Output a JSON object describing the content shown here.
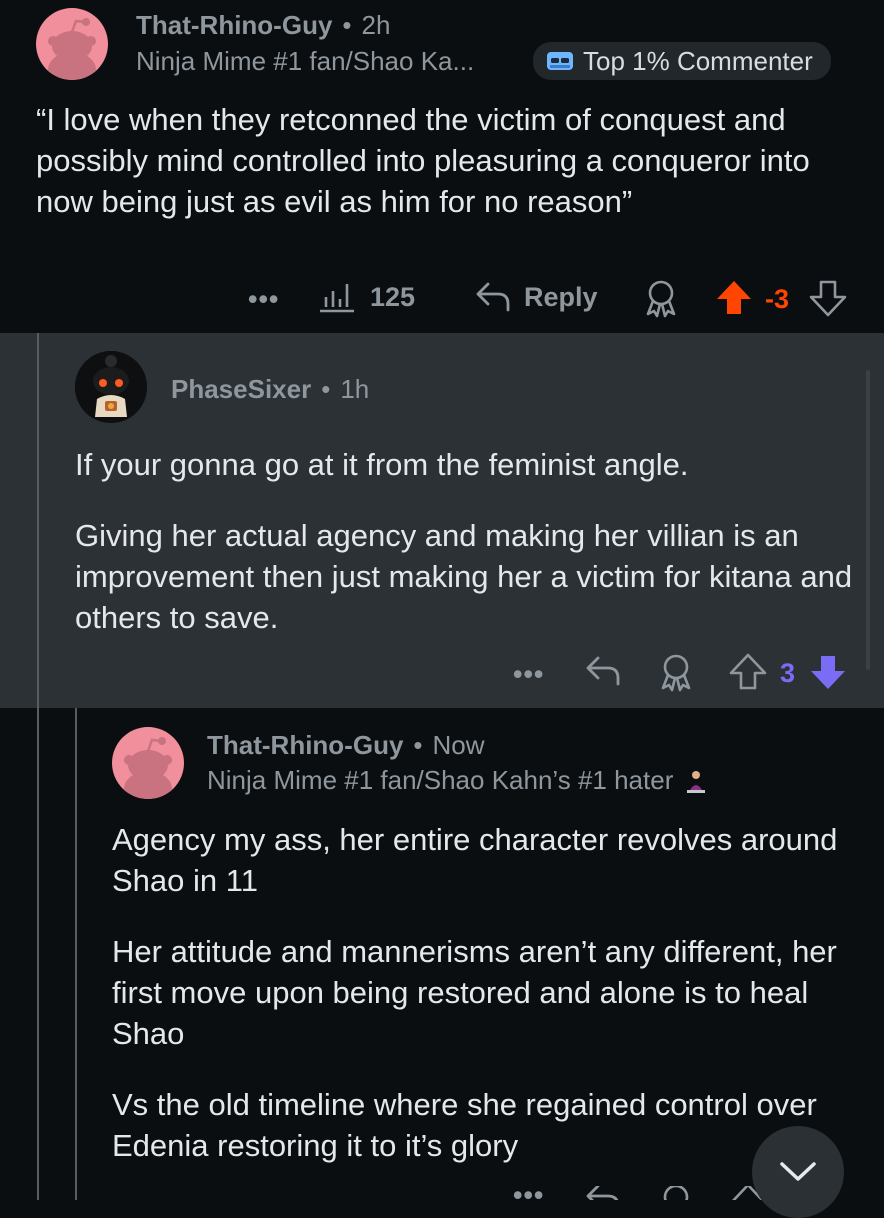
{
  "comment1": {
    "username": "That-Rhino-Guy",
    "separator": "•",
    "time": "2h",
    "flair": "Ninja Mime #1 fan/Shao Ka...",
    "badge": "Top 1% Commenter",
    "body": "“I love when they retconned the victim of conquest and possibly mind controlled into pleasuring a conqueror into now being just as evil as him for no reason”",
    "more": "•••",
    "views": "125",
    "reply": "Reply",
    "vote_count": "-3",
    "colors": {
      "upvote_active": "#ff4500",
      "vote_count": "#ff4500"
    }
  },
  "comment2": {
    "username": "PhaseSixer",
    "separator": "•",
    "time": "1h",
    "paragraphs": [
      "If your gonna go at it from the feminist angle.",
      "Giving her actual agency and making her villian is an improvement  then just making her a victim for kitana and others to save."
    ],
    "more": "•••",
    "vote_count": "3",
    "colors": {
      "downvote_active": "#7b6cf5",
      "vote_count": "#7b6cf5"
    }
  },
  "comment3": {
    "username": "That-Rhino-Guy",
    "separator": "•",
    "time": "Now",
    "flair": "Ninja Mime #1 fan/Shao Kahn’s #1 hater",
    "paragraphs": [
      "Agency my ass, her entire character revolves around Shao in 11",
      "Her attitude and mannerisms aren’t any different, her first move upon being restored and alone is to heal Shao",
      "Vs the old timeline where she regained control over Edenia restoring it to it’s glory"
    ],
    "more": "•••"
  },
  "icons": {
    "views": "bar-chart-icon",
    "reply": "reply-arrow-icon",
    "award": "award-icon",
    "upvote": "upvote-arrow-icon",
    "downvote": "downvote-arrow-icon",
    "scroll": "chevron-down-icon"
  }
}
